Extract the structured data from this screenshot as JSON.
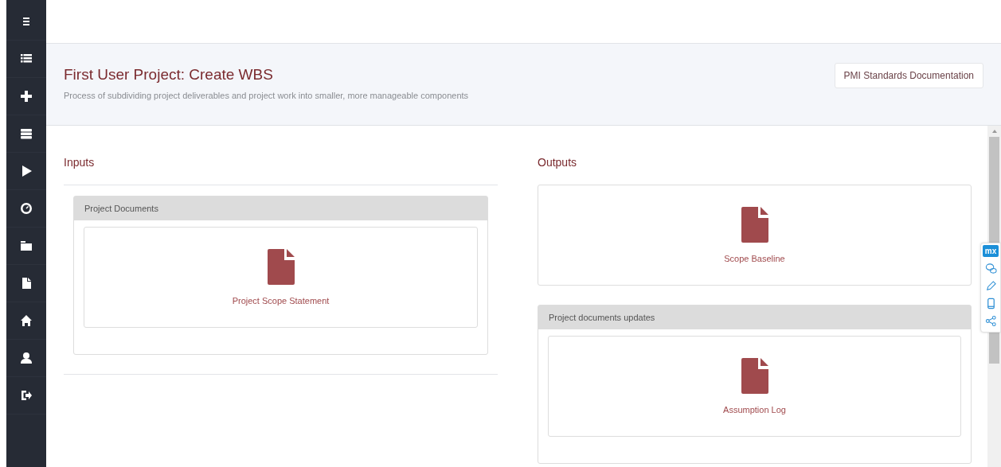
{
  "header": {
    "title": "First User Project: Create WBS",
    "description": "Process of subdividing project deliverables and project work into smaller, more manageable components",
    "button": "PMI Standards Documentation"
  },
  "inputs": {
    "title": "Inputs",
    "items": [
      {
        "kind": "group",
        "title": "Project Documents",
        "documents": [
          {
            "label": "Project Scope Statement"
          }
        ]
      }
    ]
  },
  "outputs": {
    "title": "Outputs",
    "items": [
      {
        "kind": "document",
        "label": "Scope Baseline"
      },
      {
        "kind": "group",
        "title": "Project documents updates",
        "documents": [
          {
            "label": "Assumption Log"
          }
        ]
      }
    ]
  },
  "toolbar": {
    "logo": "mx"
  }
}
